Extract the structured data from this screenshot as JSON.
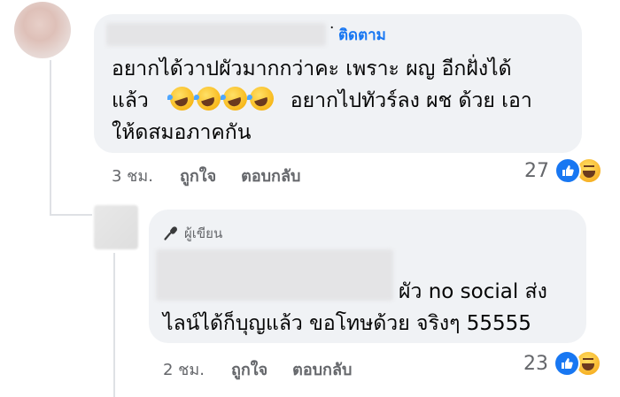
{
  "comment": {
    "follow_separator": "·",
    "follow_label": "ติดตาม",
    "text_line1": "อยากได้วาปผัวมากกว่าคะ เพราะ ผญ อีกฝั่งได้",
    "text_line2_before": "แล้ว",
    "emojis": [
      "rolling-on-floor-laughing",
      "rolling-on-floor-laughing",
      "rolling-on-floor-laughing",
      "rolling-on-floor-laughing"
    ],
    "text_line2_after": "อยากไปทัวร์ลง ผช ด้วย เอา",
    "text_line3": "ให้ดสมอภาคกัน",
    "time": "3 ชม.",
    "like_label": "ถูกใจ",
    "reply_label": "ตอบกลับ",
    "reaction_count": "27",
    "reactions": [
      "like",
      "haha"
    ]
  },
  "reply": {
    "author_badge": "ผู้เขียน",
    "text_line1": "ผัว no social ส่ง",
    "text_line2": "ไลน์ได้ก็บุญแล้ว ขอโทษด้วย จริงๆ 55555",
    "time": "2 ชม.",
    "like_label": "ถูกใจ",
    "reply_label": "ตอบกลับ",
    "reaction_count": "23",
    "reactions": [
      "like",
      "haha"
    ]
  },
  "colors": {
    "bubble": "#f0f2f5",
    "link": "#1877f2",
    "secondary_text": "#65676b",
    "like": "#1877f2"
  }
}
